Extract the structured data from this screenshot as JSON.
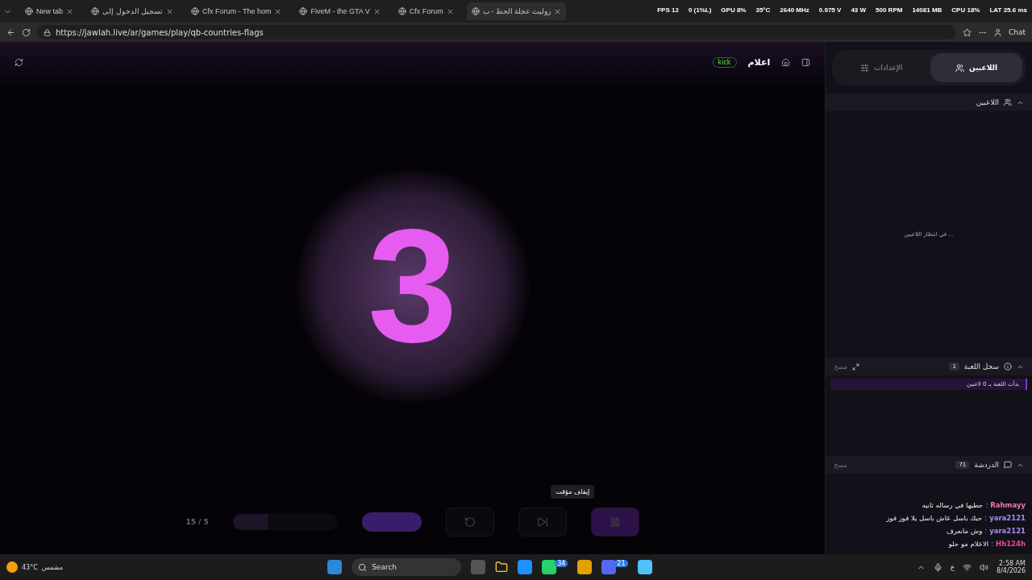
{
  "browser": {
    "tabs": [
      {
        "title": "روليت عجلة الحظ - ب",
        "selected": true
      },
      {
        "title": "Cfx Forum",
        "selected": false
      },
      {
        "title": "FiveM - the GTA V",
        "selected": false
      },
      {
        "title": "Cfx Forum - The hom",
        "selected": false
      },
      {
        "title": "تسجيل الدخول إلى",
        "selected": false
      },
      {
        "title": "New tab",
        "selected": false
      }
    ],
    "overlay": [
      "LAT 25.6 ms",
      "CPU 18%",
      "14081 MB",
      "500 RPM",
      "43 W",
      "0.975 V",
      "2640 MHz",
      "35°C",
      "GPU 8%",
      "0 (1%L)",
      "FPS 12"
    ],
    "url": "https://jawlah.live/ar/games/play/qb-countries-flags",
    "chat_button": "Chat"
  },
  "game": {
    "title": "اعلام",
    "kick_label": "kick",
    "countdown": "3",
    "progress": {
      "text": "15 / 5",
      "level": 0.33
    },
    "tooltip": "إيقاف مؤقت"
  },
  "panel": {
    "tabs": [
      {
        "label": "اللاعبين",
        "selected": true
      },
      {
        "label": "الإعدادات",
        "selected": false
      }
    ],
    "players": {
      "title": "اللاعبين",
      "expanded": true,
      "empty_text": "في انتظار اللاعبين ..."
    },
    "log": {
      "title": "سجل اللعبة",
      "count": "1",
      "clear": "مسح",
      "entries": [
        "بدأت اللعبة بـ 0 لاعبين"
      ]
    },
    "chat": {
      "title": "الدردشة",
      "count": "71",
      "clear": "مسح",
      "messages": [
        {
          "user": "Rahmayy",
          "separator": ":",
          "text": "حطيها في رساله ثانيه",
          "color": "#f472b6"
        },
        {
          "user": "yara2121",
          "separator": ":",
          "text": "حبك باسل عاش باسل يلا فوز فوز",
          "color": "#a78bfa"
        },
        {
          "user": "yara2121",
          "separator": ":",
          "text": "وش مانعرف",
          "color": "#a78bfa"
        },
        {
          "user": "Hh124h",
          "separator": ":",
          "text": "الاعلام مو حلو",
          "color": "#ec4899"
        }
      ]
    }
  },
  "taskbar": {
    "temperature": "43°C",
    "weather": "مشمس",
    "search": "Search",
    "badges": [
      "21",
      "34"
    ],
    "lang": "ع",
    "time": "2:58 AM",
    "date": "8/4/2026"
  }
}
